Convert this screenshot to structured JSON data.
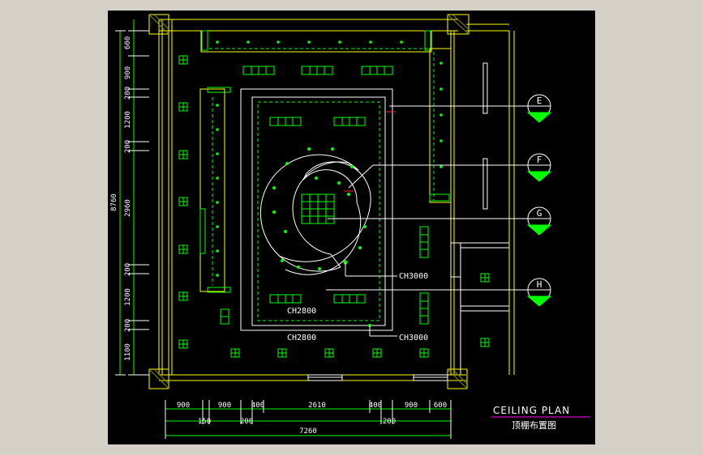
{
  "dims_left": [
    "600",
    "900",
    "200",
    "1200",
    "200",
    "2960",
    "200",
    "1200",
    "200",
    "1100"
  ],
  "dim_left_total": "8760",
  "dims_bottom_top": [
    "900",
    "900",
    "400",
    "2610",
    "400",
    "900",
    "600"
  ],
  "dims_bottom_mid": [
    "150",
    "200",
    "200"
  ],
  "dim_bottom_total": "7260",
  "ceiling_labels": [
    "CH2800",
    "CH2800"
  ],
  "ch3000_labels": [
    "CH3000",
    "CH3000"
  ],
  "sections": [
    "E",
    "F",
    "G",
    "H"
  ],
  "title_en": "CEILING PLAN",
  "title_cn": "顶棚布置图",
  "colors": {
    "background": "#000000",
    "walls": "#ffff00",
    "fixtures": "#00ff00",
    "lines": "#ffffff",
    "accent": "#ff00ff"
  }
}
